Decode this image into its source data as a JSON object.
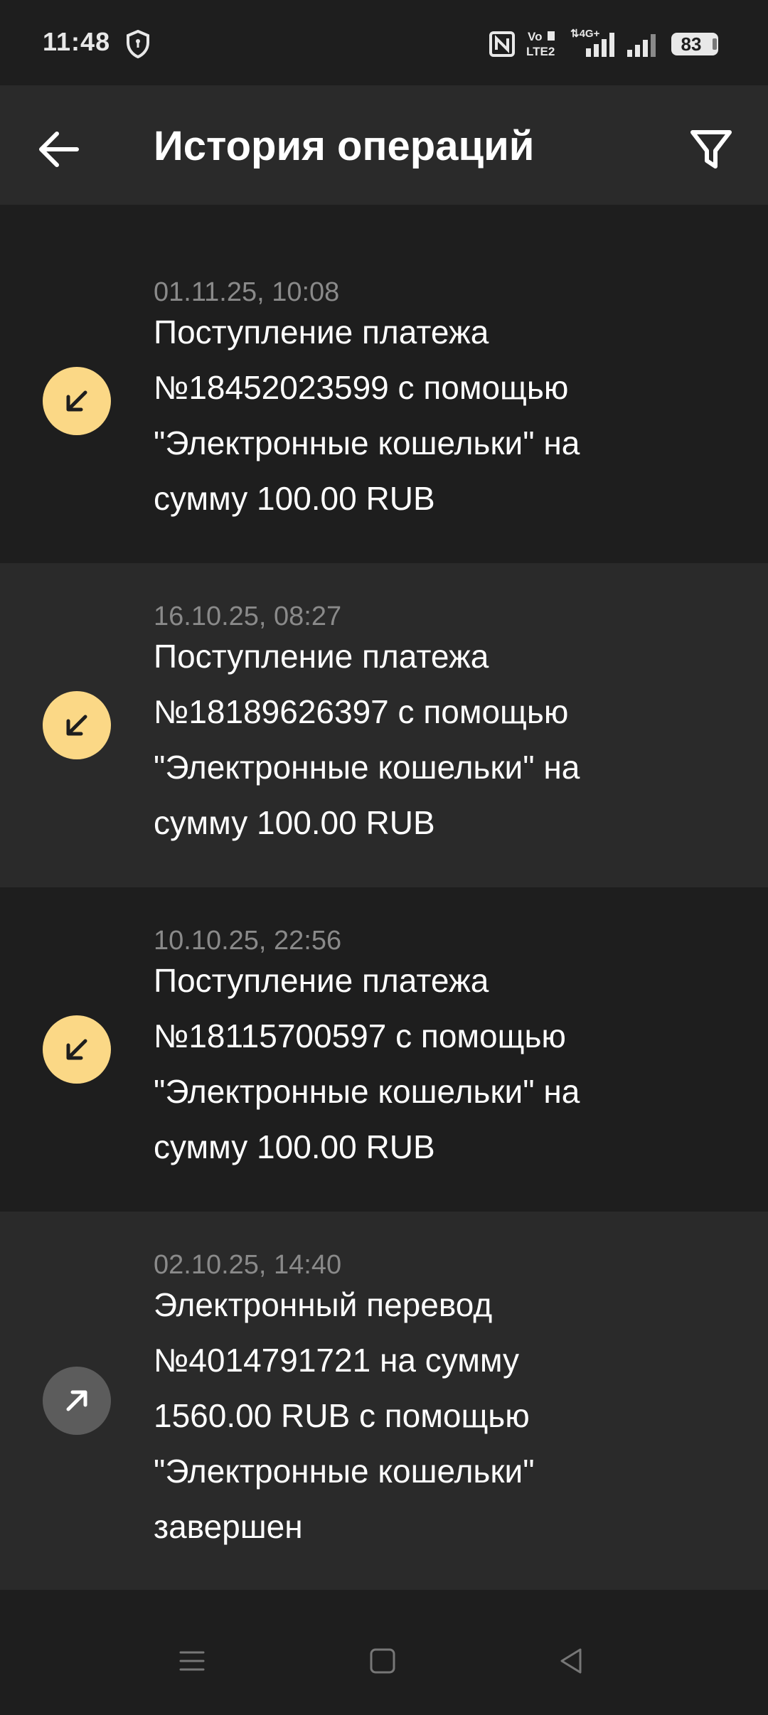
{
  "status_bar": {
    "time": "11:48",
    "battery_level": "83",
    "icons": [
      "shield-icon",
      "nfc-icon",
      "volte-icon",
      "signal-4g-icon",
      "signal-icon",
      "battery-icon"
    ]
  },
  "header": {
    "title": "История операций",
    "back_icon": "arrow-left-icon",
    "filter_icon": "filter-icon"
  },
  "transactions": [
    {
      "date": "01.11.25, 10:08",
      "lines": [
        "Поступление платежа",
        "№18452023599 с помощью",
        "\"Электронные кошельки\" на",
        "сумму 100.00 RUB"
      ],
      "direction": "incoming"
    },
    {
      "date": "16.10.25, 08:27",
      "lines": [
        "Поступление платежа",
        "№18189626397 с помощью",
        "\"Электронные кошельки\" на",
        "сумму 100.00 RUB"
      ],
      "direction": "incoming"
    },
    {
      "date": "10.10.25, 22:56",
      "lines": [
        "Поступление платежа",
        "№18115700597 с помощью",
        "\"Электронные кошельки\" на",
        "сумму 100.00 RUB"
      ],
      "direction": "incoming"
    },
    {
      "date": "02.10.25, 14:40",
      "lines": [
        "Электронный перевод",
        "№4014791721 на сумму",
        "1560.00 RUB с помощью",
        "\"Электронные кошельки\"",
        "завершен"
      ],
      "direction": "outgoing"
    }
  ],
  "colors": {
    "background": "#1e1e1e",
    "row_alt": "#2a2a2a",
    "incoming_icon": "#fbd886",
    "outgoing_icon": "#5c5c5c",
    "date_text": "#8a8a8a"
  },
  "nav_bar": {
    "icons": [
      "menu-icon",
      "home-square-icon",
      "back-triangle-icon"
    ]
  }
}
